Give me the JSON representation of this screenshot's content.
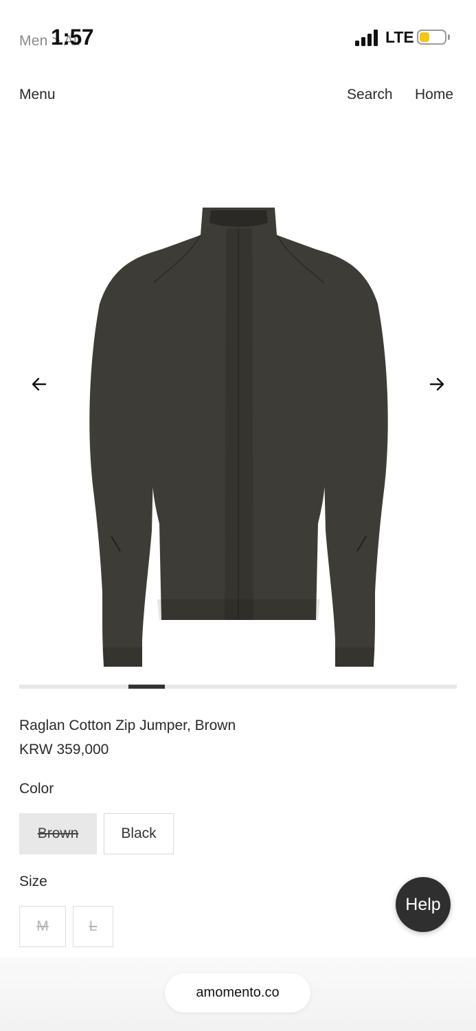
{
  "status_bar": {
    "breadcrumb": "Men > All",
    "time": "1:57",
    "network": "LTE",
    "battery_color": "#f5c518",
    "battery_level": 0.4
  },
  "header": {
    "menu_label": "Menu",
    "search_label": "Search",
    "home_label": "Home"
  },
  "gallery": {
    "image_icon": "jacket-product-image",
    "prev_icon": "arrow-left-icon",
    "next_icon": "arrow-right-icon",
    "image_count": 12,
    "current_index": 4,
    "jacket_color": "#3e3c36"
  },
  "product": {
    "name": "Raglan Cotton Zip Jumper, Brown",
    "price": "KRW 359,000"
  },
  "options": {
    "color_label": "Color",
    "colors": [
      "Brown",
      "Black"
    ],
    "size_label": "Size",
    "sizes": [
      "M",
      "L"
    ]
  },
  "help": {
    "label": "Help"
  },
  "browser": {
    "url": "amomento.co"
  }
}
